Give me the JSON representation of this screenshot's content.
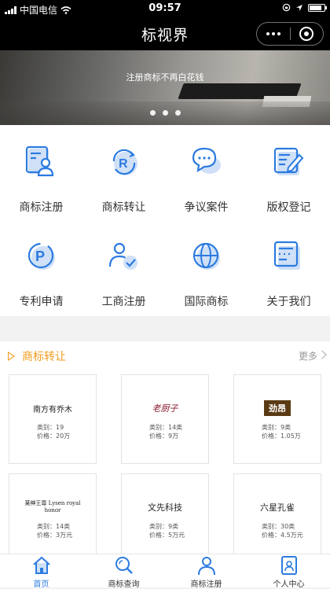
{
  "status": {
    "carrier": "中国电信",
    "time": "09:57"
  },
  "nav": {
    "title": "标视界"
  },
  "banner": {
    "caption": "注册商标不再白花钱"
  },
  "services": [
    {
      "label": "商标注册",
      "icon": "trademark-register-icon"
    },
    {
      "label": "商标转让",
      "icon": "trademark-transfer-icon"
    },
    {
      "label": "争议案件",
      "icon": "dispute-case-icon"
    },
    {
      "label": "版权登记",
      "icon": "copyright-register-icon"
    },
    {
      "label": "专利申请",
      "icon": "patent-apply-icon"
    },
    {
      "label": "工商注册",
      "icon": "business-register-icon"
    },
    {
      "label": "国际商标",
      "icon": "international-trademark-icon"
    },
    {
      "label": "关于我们",
      "icon": "about-us-icon"
    }
  ],
  "transfer": {
    "title": "商标转让",
    "more": "更多",
    "cards": [
      {
        "logo": "南方有乔木",
        "category": "类别：19",
        "price": "价格：20万"
      },
      {
        "logo": "老厨子",
        "category": "类别：14类",
        "price": "价格：9万"
      },
      {
        "logo": "劲昂",
        "category": "类别：9类",
        "price": "价格：1.05万"
      },
      {
        "logo": "莱绅王尊 Lysen royal honor",
        "category": "类别：14类",
        "price": "价格：3万元"
      },
      {
        "logo": "文先科技",
        "category": "类别：9类",
        "price": "价格：5万元"
      },
      {
        "logo": "六星孔雀",
        "category": "类别：30类",
        "price": "价格：4.5万元"
      }
    ]
  },
  "tabs": [
    {
      "label": "首页",
      "icon": "home-icon"
    },
    {
      "label": "商标查询",
      "icon": "search-icon"
    },
    {
      "label": "商标注册",
      "icon": "user-icon"
    },
    {
      "label": "个人中心",
      "icon": "profile-card-icon"
    }
  ],
  "colors": {
    "accent": "#f29a19",
    "icon_blue": "#2c7be0",
    "icon_tint": "#cfe0f7"
  }
}
